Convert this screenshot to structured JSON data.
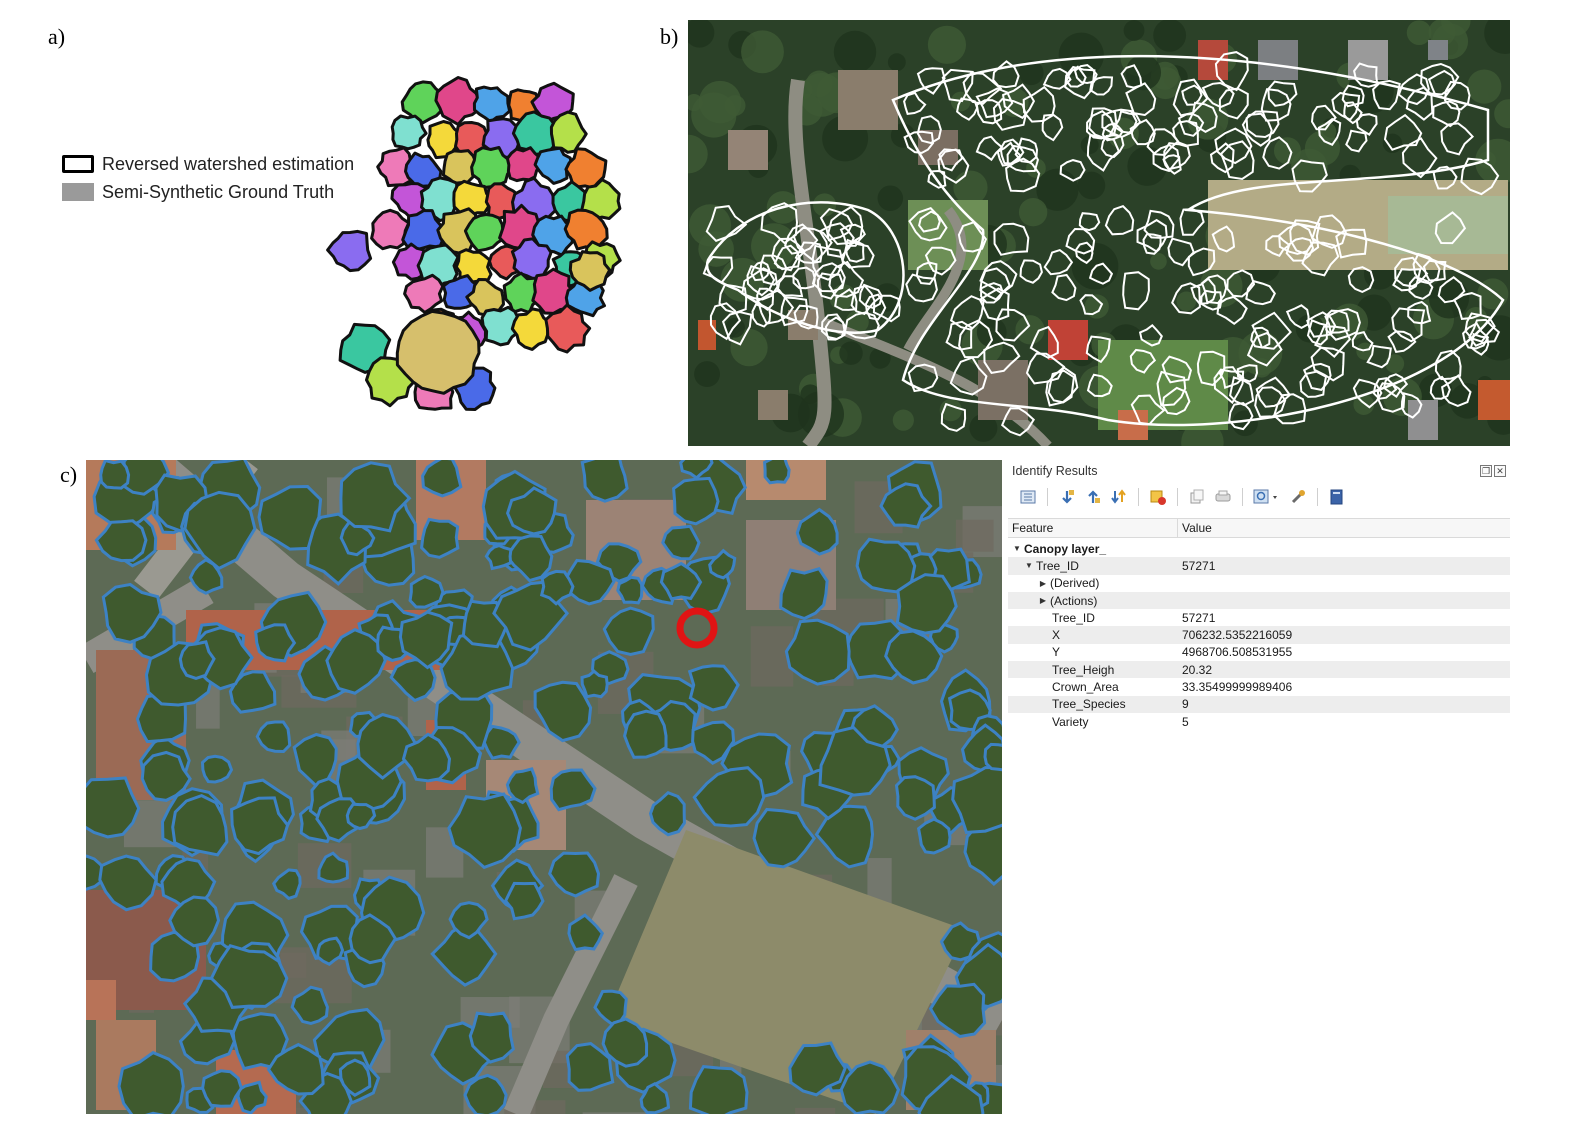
{
  "panel_labels": {
    "a": "a)",
    "b": "b)",
    "c": "c)"
  },
  "legend": {
    "items": [
      {
        "label": "Reversed watershed estimation",
        "style": "outline",
        "color": "#000000"
      },
      {
        "label": "Semi-Synthetic Ground Truth",
        "style": "fill",
        "color": "#9a9a9a"
      }
    ]
  },
  "identify_results": {
    "title": "Identify Results",
    "columns": {
      "feature": "Feature",
      "value": "Value"
    },
    "layer": "Canopy layer_",
    "feature_row": {
      "label": "Tree_ID",
      "value": "57271"
    },
    "sub_nodes": [
      "(Derived)",
      "(Actions)"
    ],
    "attributes": [
      {
        "name": "Tree_ID",
        "value": "57271"
      },
      {
        "name": "X",
        "value": "706232.5352216059"
      },
      {
        "name": "Y",
        "value": "4968706.508531955"
      },
      {
        "name": "Tree_Heigh",
        "value": "20.32"
      },
      {
        "name": "Crown_Area",
        "value": "33.35499999989406"
      },
      {
        "name": "Tree_Species",
        "value": "9"
      },
      {
        "name": "Variety",
        "value": "5"
      }
    ]
  },
  "colors": {
    "crown_outline_c": "#3d82c4",
    "selected_crown": "#e01414",
    "crown_outline_b": "#ffffff"
  }
}
